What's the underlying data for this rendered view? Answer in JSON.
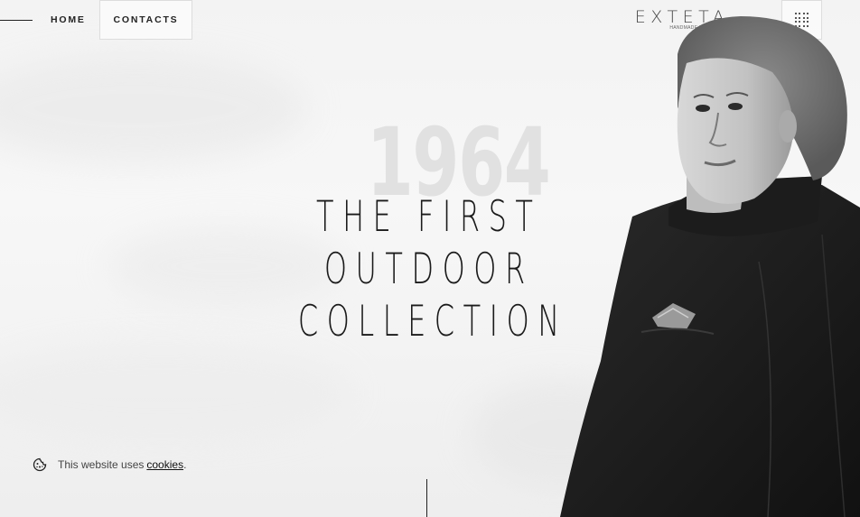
{
  "nav": {
    "home_label": "HOME",
    "contacts_label": "CONTACTS",
    "menu_icon": "grid-dots-icon"
  },
  "brand": {
    "logo_text": "EXTETA",
    "tagline": "HANDMADE IN ITALY"
  },
  "hero": {
    "year": "1964",
    "headline_lines": [
      "THE FIRST",
      "OUTDOOR",
      "COLLECTION"
    ],
    "image": "black-and-white portrait of woman in dark coat"
  },
  "cookie_notice": {
    "text": "This website uses",
    "link_label": "cookies",
    "suffix": ".",
    "icon": "cookie-icon"
  },
  "colors": {
    "text": "#1a1a1a",
    "year_watermark": "#e1e1e1",
    "background": "#f4f4f4"
  }
}
